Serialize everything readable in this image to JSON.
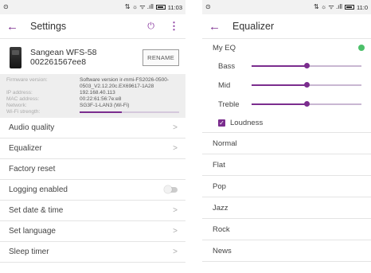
{
  "left": {
    "statusbar": {
      "left_icon": "⊙",
      "right_icons": "⇅ ☼ ᯤ .ıll",
      "time": "11:03"
    },
    "appbar": {
      "title": "Settings",
      "back_icon": "←",
      "power_icon": "⏻",
      "menu_icon": "⋮"
    },
    "device": {
      "name_line1": "Sangean WFS-58",
      "name_line2": "002261567ee8",
      "rename_label": "RENAME"
    },
    "info": {
      "firmware_label": "Firmware version:",
      "firmware_value": "Software version ir-mmi-FS2026-0500-0503_V2.12.20c.EX69617-1A28",
      "ip_label": "IP address:",
      "ip_value": "192.168.40.113",
      "mac_label": "MAC address:",
      "mac_value": "00:22:61:56:7e:e8",
      "network_label": "Network:",
      "network_value": "SG3F-1-LAN3 (Wi-Fi)",
      "wifi_label": "Wi-Fi strength:",
      "wifi_strength": 0.42
    },
    "menu": {
      "audio_quality": "Audio quality",
      "equalizer": "Equalizer",
      "factory_reset": "Factory reset",
      "logging_enabled": "Logging enabled",
      "set_date_time": "Set date & time",
      "set_language": "Set language",
      "sleep_timer": "Sleep timer",
      "chevron": ">"
    }
  },
  "right": {
    "statusbar": {
      "left_icon": "⊙",
      "right_icons": "⇅ ☼ ᯤ .ıll",
      "time": "11:0"
    },
    "appbar": {
      "title": "Equalizer",
      "back_icon": "←"
    },
    "my_eq_label": "My EQ",
    "sliders": {
      "bass_label": "Bass",
      "bass_value": 0.5,
      "mid_label": "Mid",
      "mid_value": 0.5,
      "treble_label": "Treble",
      "treble_value": 0.5
    },
    "loudness_label": "Loudness",
    "loudness_check": "✓",
    "presets": {
      "normal": "Normal",
      "flat": "Flat",
      "pop": "Pop",
      "jazz": "Jazz",
      "rock": "Rock",
      "news": "News"
    },
    "accent_color": "#7b2d8e",
    "check_color": "#4cc06a"
  }
}
